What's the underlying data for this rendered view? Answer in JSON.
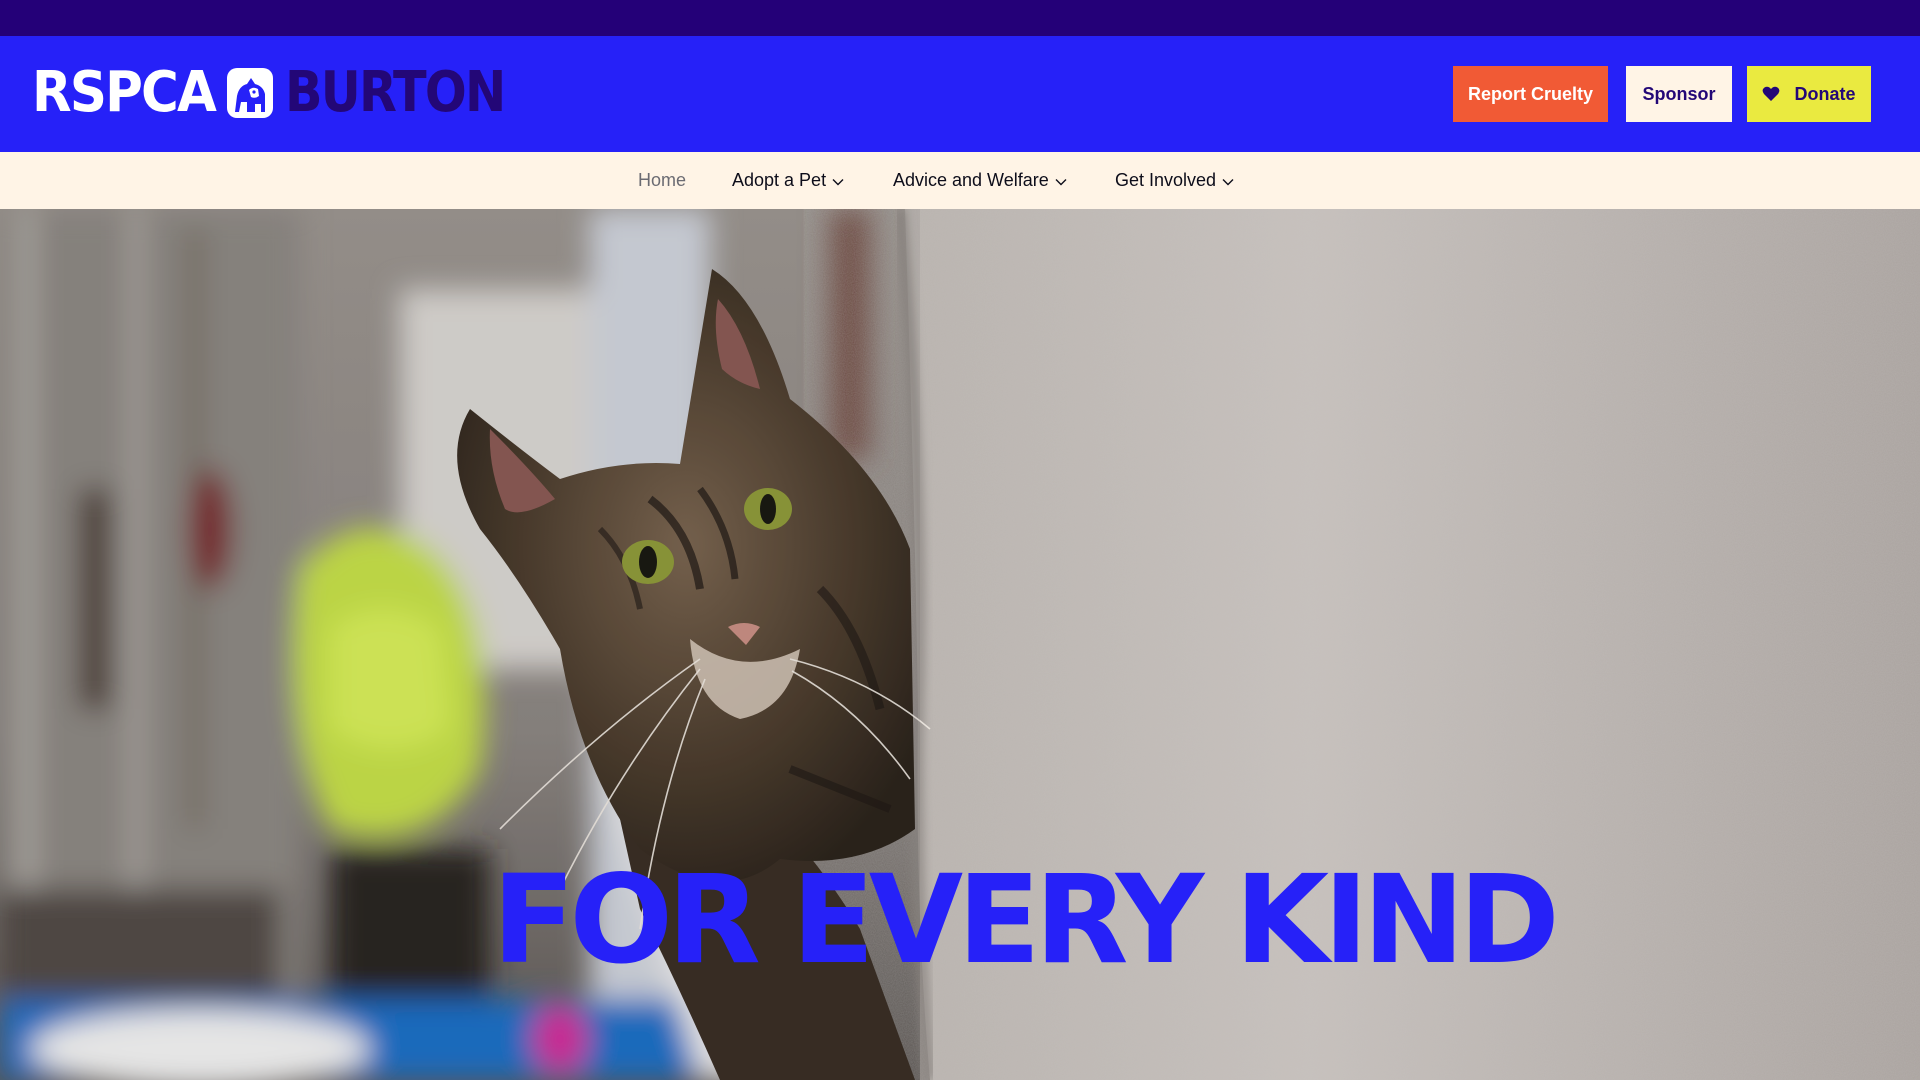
{
  "brand": {
    "name_primary": "RSPCA",
    "name_branch": "BURTON",
    "colors": {
      "top_strip": "#240078",
      "header": "#2621f8",
      "nav_bg": "#fff4e6",
      "report": "#f15a35",
      "donate": "#eaea40",
      "dark_text": "#230777"
    },
    "badge_icon": "dog-and-cat-badge-icon"
  },
  "header_buttons": {
    "report_label": "Report Cruelty",
    "sponsor_label": "Sponsor",
    "donate_label": "Donate",
    "donate_icon": "heart-icon"
  },
  "nav": {
    "items": [
      {
        "label": "Home",
        "has_dropdown": false
      },
      {
        "label": "Adopt a Pet",
        "has_dropdown": true
      },
      {
        "label": "Advice and Welfare",
        "has_dropdown": true
      },
      {
        "label": "Get Involved",
        "has_dropdown": true
      }
    ]
  },
  "hero": {
    "title": "FOR EVERY KIND",
    "image": "tabby-cat-peeking-around-concrete-wall"
  }
}
